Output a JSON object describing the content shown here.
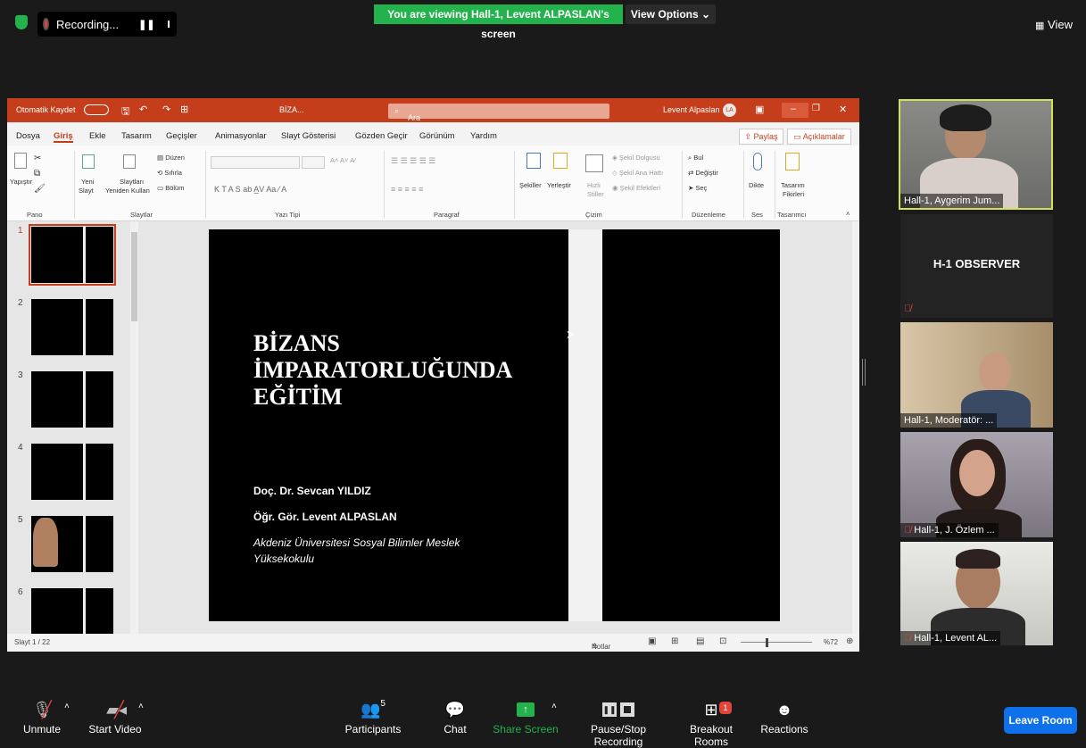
{
  "zoom_bar": {
    "recording_label": "Recording...",
    "viewing_banner": "You are viewing Hall-1, Levent ALPASLAN's screen",
    "view_options": "View Options",
    "view_label": "View"
  },
  "ppt": {
    "autosave": "Otomatik Kaydet",
    "filename": "BİZA...",
    "search": "Ara",
    "user_name": "Levent Alpaslan",
    "user_initials": "LA",
    "menu": [
      "Dosya",
      "Giriş",
      "Ekle",
      "Tasarım",
      "Geçişler",
      "Animasyonlar",
      "Slayt Gösterisi",
      "Gözden Geçir",
      "Görünüm",
      "Yardım"
    ],
    "share": "Paylaş",
    "comments": "Açıklamalar",
    "ribbon": {
      "paste": "Yapıştır",
      "new_slide": "Yeni",
      "new_slide2": "Slayt",
      "reuse": "Slaytları",
      "reuse2": "Yeniden Kullan",
      "layout": "Düzen",
      "reset": "Sıfırla",
      "section": "Bölüm",
      "shapes": "Şekiller",
      "arrange": "Yerleştir",
      "quick": "Hızlı",
      "quick2": "Stiller",
      "shape_fill": "Şekil Dolgusu",
      "shape_outline": "Şekil Ana Hattı",
      "shape_effects": "Şekil Efektleri",
      "find": "Bul",
      "replace": "Değiştir",
      "select": "Seç",
      "dictate": "Dikte",
      "designer": "Tasarım",
      "designer2": "Fikirleri",
      "groups": [
        "Pano",
        "Slaytlar",
        "Yazı Tipi",
        "Paragraf",
        "Çizim",
        "Düzenleme",
        "Ses",
        "Tasarımcı"
      ]
    },
    "slide_numbers": [
      "1",
      "2",
      "3",
      "4",
      "5",
      "6"
    ],
    "slide": {
      "title": "BİZANS\nİMPARATORLUĞUNDA\nEĞİTİM",
      "author1": "Doç. Dr. Sevcan YILDIZ",
      "author2": "Öğr. Gör. Levent ALPASLAN",
      "institution": "Akdeniz Üniversitesi Sosyal Bilimler Meslek Yüksekokulu"
    },
    "status": {
      "slide_count": "Slayt 1 / 22",
      "notes": "Notlar",
      "zoom": "%72"
    }
  },
  "participants_panel": {
    "tiles": [
      {
        "label": "Hall-1, Aygerim Jum...",
        "muted": false
      },
      {
        "label": "H-1 OBSERVER",
        "muted": true
      },
      {
        "label": "Hall-1, Moderatör: ...",
        "muted": false
      },
      {
        "label": "Hall-1, J. Özlem ...",
        "muted": true
      },
      {
        "label": "Hall-1, Levent AL...",
        "muted": true
      }
    ]
  },
  "toolbar": {
    "unmute": "Unmute",
    "start_video": "Start Video",
    "participants": "Participants",
    "participants_count": "5",
    "chat": "Chat",
    "share_screen": "Share Screen",
    "pause_stop": "Pause/Stop Recording",
    "breakout": "Breakout Rooms",
    "breakout_badge": "1",
    "reactions": "Reactions",
    "leave": "Leave Room"
  },
  "colors": {
    "zoom_green": "#23b24c",
    "ppt_red": "#c43e1c",
    "leave_blue": "#0e71eb",
    "mute_red": "#e0443b"
  }
}
